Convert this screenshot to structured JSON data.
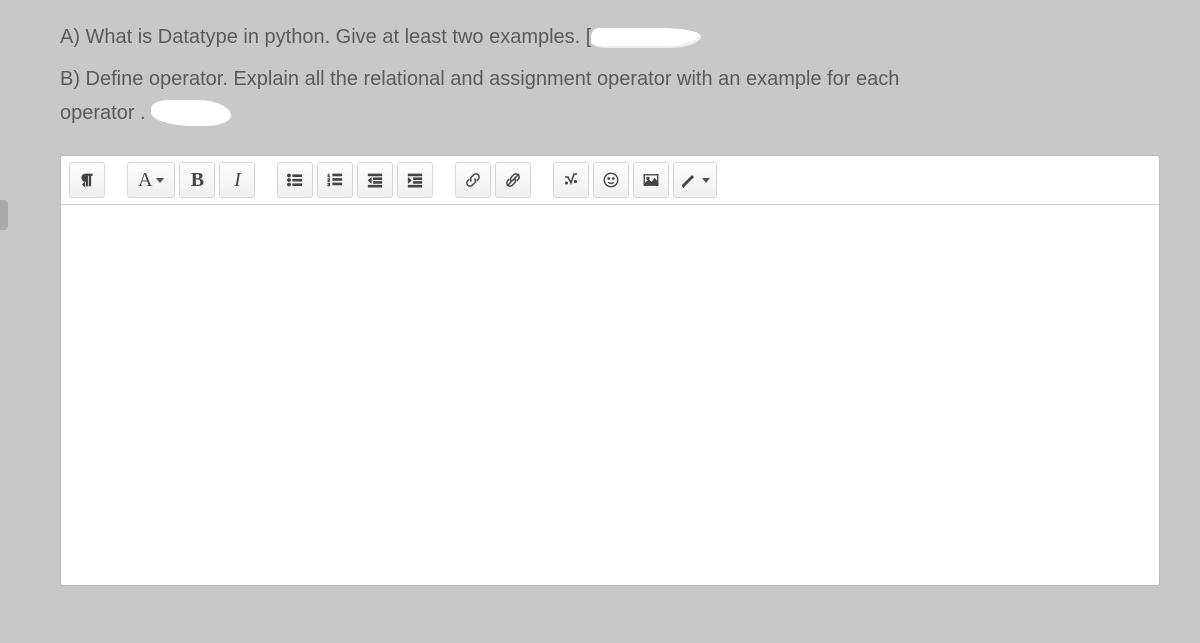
{
  "questions": {
    "a": "A) What is Datatype in python. Give at least two examples. [",
    "b_line1": "B) Define operator. Explain all the relational and assignment operator with an example for each",
    "b_line2": "operator . "
  },
  "toolbar": {
    "paragraph_label": "¶",
    "fontcolor_label": "A",
    "bold_label": "B",
    "italic_label": "I"
  }
}
